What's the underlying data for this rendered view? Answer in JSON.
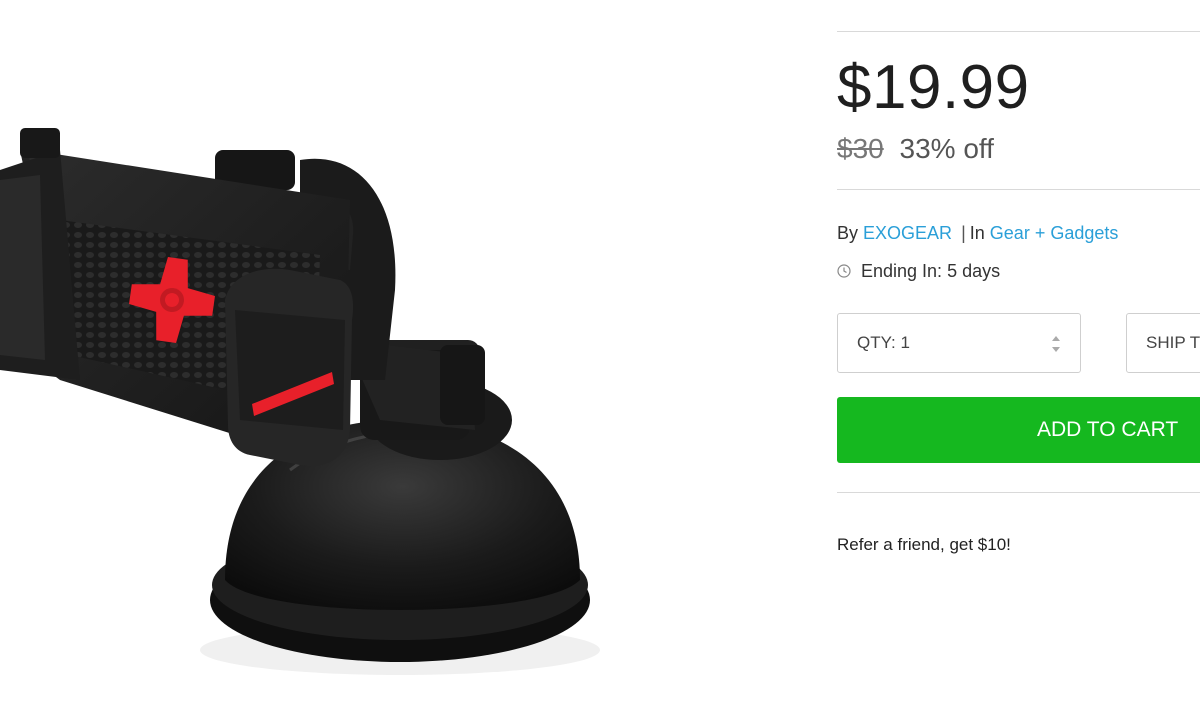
{
  "product": {
    "image_alt_name": "car-phone-mount"
  },
  "pricing": {
    "price": "$19.99",
    "original_price": "$30",
    "discount": "33% off"
  },
  "byline": {
    "by_label": "By",
    "brand": "EXOGEAR",
    "separator": "|",
    "in_label": "In",
    "category": "Gear + Gadgets"
  },
  "timer": {
    "icon": "clock-icon",
    "text": "Ending In: 5 days"
  },
  "quantity": {
    "label": "QTY: 1",
    "icon": "stepper-icon"
  },
  "shipping": {
    "label": "SHIP T"
  },
  "cart": {
    "button_label": "ADD TO CART"
  },
  "referral": {
    "text": "Refer a friend, get $10!"
  },
  "colors": {
    "accent_green": "#15b81f",
    "link_blue": "#2a9fd8",
    "product_red": "#e8202a"
  }
}
